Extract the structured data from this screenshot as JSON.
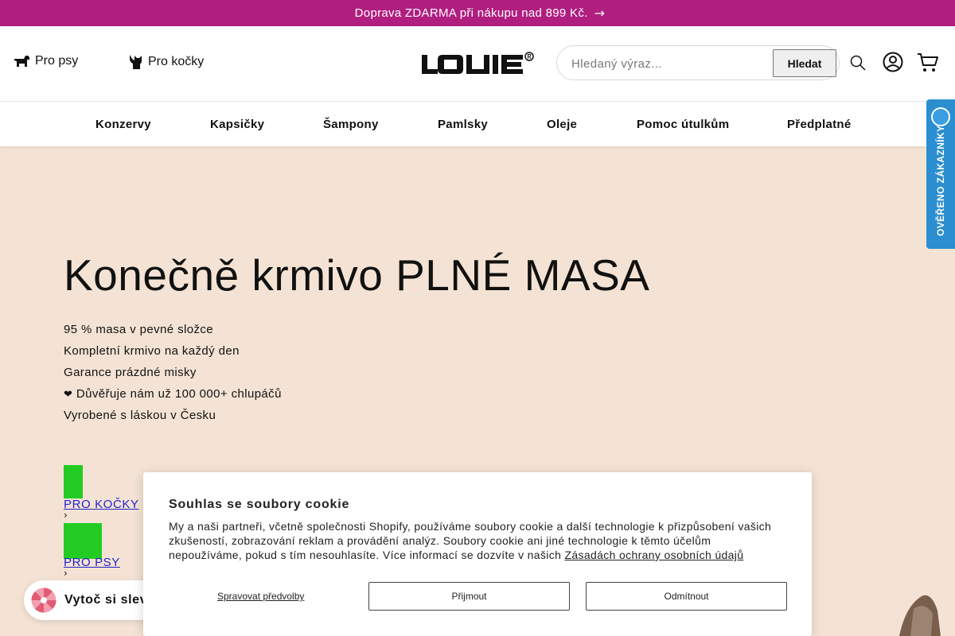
{
  "announcement": {
    "glyph": "",
    "text": "Doprava ZDARMA při nákupu nad 899 Kč.",
    "arrow": "→"
  },
  "header": {
    "dogs_label": "Pro psy",
    "cats_label": "Pro kočky",
    "search_placeholder": "Hledaný výraz...",
    "search_button": "Hledat"
  },
  "nav": {
    "items": [
      {
        "label": "Konzervy"
      },
      {
        "label": "Kapsičky"
      },
      {
        "label": "Šampony"
      },
      {
        "label": "Pamlsky"
      },
      {
        "label": "Oleje"
      },
      {
        "label": "Pomoc útulkům"
      },
      {
        "label": "Předplatné"
      }
    ]
  },
  "badge": {
    "text": "OVĚŘENO ZÁKAZNÍKY"
  },
  "hero": {
    "title": "Konečně krmivo PLNÉ MASA",
    "bullets": [
      {
        "icon": "",
        "text": "95 % masa v pevné složce"
      },
      {
        "icon": "",
        "text": "Kompletní krmivo na každý den"
      },
      {
        "icon": "",
        "text": "Garance prázdné misky"
      },
      {
        "icon": "❤",
        "text": "Důvěřuje nám už 100 000+ chlupáčů"
      },
      {
        "icon": "",
        "text": "Vyrobené s láskou v Česku"
      }
    ],
    "cta_cats": "PRO KOČKY",
    "cta_dogs": "PRO PSY",
    "cta_arrow": "›"
  },
  "spin_widget": {
    "label": "Vytoč si slevu"
  },
  "cookie": {
    "title": "Souhlas se soubory cookie",
    "body": "My a naši partneři, včetně společnosti Shopify, používáme soubory cookie a další technologie k přizpůsobení vašich zkušeností, zobrazování reklam a provádění analýz. Soubory cookie ani jiné technologie k těmto účelům nepoužíváme, pokud s tím nesouhlasíte. Více informací se dozvíte v našich ",
    "policy_link": "Zásadách ochrany osobních údajů",
    "manage": "Spravovat předvolby",
    "accept": "Přijmout",
    "decline": "Odmítnout"
  },
  "colors": {
    "announcement_bg": "#b01e80",
    "hero_bg": "#f4e3d4",
    "badge_bg": "#2a8ed0",
    "cta_block": "#22cc22"
  }
}
